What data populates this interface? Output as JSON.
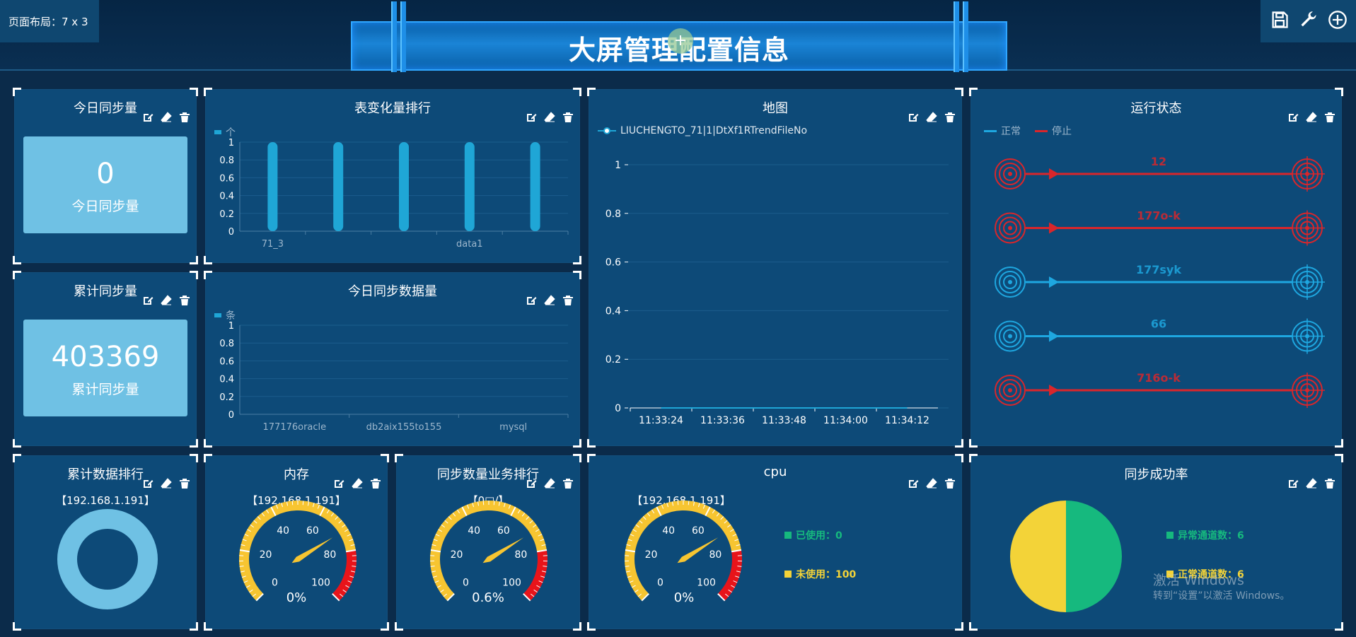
{
  "header": {
    "layout_label": "页面布局：7 x 3",
    "title": "大屏管理配置信息",
    "add_label": "+"
  },
  "toolbar": {
    "icons": [
      "save-icon",
      "wrench-icon",
      "add-circle-icon"
    ]
  },
  "panel_actions": [
    "edit-icon",
    "eraser-icon",
    "trash-icon"
  ],
  "panels": {
    "today_sync": {
      "title": "今日同步量",
      "value": "0",
      "label": "今日同步量"
    },
    "total_sync": {
      "title": "累计同步量",
      "value": "403369",
      "label": "累计同步量"
    },
    "table_change": {
      "title": "表变化量排行",
      "legend": "个"
    },
    "today_data": {
      "title": "今日同步数据量",
      "legend": "条"
    },
    "map": {
      "title": "地图",
      "legend": "LIUCHENGTO_71|1|DtXf1RTrendFileNo"
    },
    "run_status": {
      "title": "运行状态",
      "legend_normal": "正常",
      "legend_stop": "停止",
      "rows": [
        {
          "name": "12",
          "status": "stop"
        },
        {
          "name": "177o-k",
          "status": "stop"
        },
        {
          "name": "177syk",
          "status": "normal"
        },
        {
          "name": "66",
          "status": "normal"
        },
        {
          "name": "716o-k",
          "status": "stop"
        }
      ]
    },
    "total_rank": {
      "title": "累计数据排行",
      "subtitle": "【192.168.1.191】"
    },
    "memory": {
      "title": "内存",
      "subtitle": "【192.168.1.191】",
      "value": "0%"
    },
    "biz_rank": {
      "title": "同步数量业务排行",
      "subtitle": "【0□/】",
      "value": "0.6%"
    },
    "cpu": {
      "title": "cpu",
      "subtitle": "【192.168.1.191】",
      "value": "0%",
      "used": "已使用：0",
      "unused": "未使用：100"
    },
    "success_rate": {
      "title": "同步成功率",
      "abnormal": "异常通道数：6",
      "normal": "正常通道数：6"
    }
  },
  "gauge_ticks": [
    "0",
    "20",
    "40",
    "60",
    "80",
    "100"
  ],
  "watermark": {
    "line1": "激活 Windows",
    "line2": "转到“设置”以激活 Windows。"
  },
  "colors": {
    "accent": "#1fa6d6",
    "stop": "#d9262b",
    "normal": "#1ea7e0",
    "gauge_yellow": "#f7c531",
    "gauge_red": "#e8141a",
    "pie_green": "#16b97e",
    "pie_yellow": "#f3d338"
  },
  "chart_data": [
    {
      "type": "bar",
      "title": "表变化量排行",
      "series": [
        {
          "name": "个",
          "values": [
            1,
            1,
            1,
            1,
            1
          ]
        }
      ],
      "categories": [
        "71_3",
        "",
        "",
        "data1",
        ""
      ],
      "ylim": [
        0,
        1
      ],
      "yticks": [
        "0",
        "0.2",
        "0.4",
        "0.6",
        "0.8",
        "1"
      ]
    },
    {
      "type": "bar",
      "title": "今日同步数据量",
      "series": [
        {
          "name": "条",
          "values": [
            0,
            0,
            0
          ]
        }
      ],
      "categories": [
        "177176oracle",
        "db2aix155to155",
        "mysql"
      ],
      "ylim": [
        0,
        1
      ],
      "yticks": [
        "0",
        "0.2",
        "0.4",
        "0.6",
        "0.8",
        "1"
      ]
    },
    {
      "type": "line",
      "title": "地图",
      "series": [
        {
          "name": "LIUCHENGTO_71|1|DtXf1RTrendFileNo",
          "values": [
            0,
            0,
            0,
            0,
            0
          ]
        }
      ],
      "x": [
        "11:33:24",
        "11:33:36",
        "11:33:48",
        "11:34:00",
        "11:34:12"
      ],
      "ylim": [
        0,
        1
      ],
      "yticks": [
        "0",
        "0.2",
        "0.4",
        "0.6",
        "0.8",
        "1"
      ]
    },
    {
      "type": "pie",
      "title": "同步成功率",
      "categories": [
        "异常通道数",
        "正常通道数"
      ],
      "values": [
        6,
        6
      ]
    }
  ]
}
